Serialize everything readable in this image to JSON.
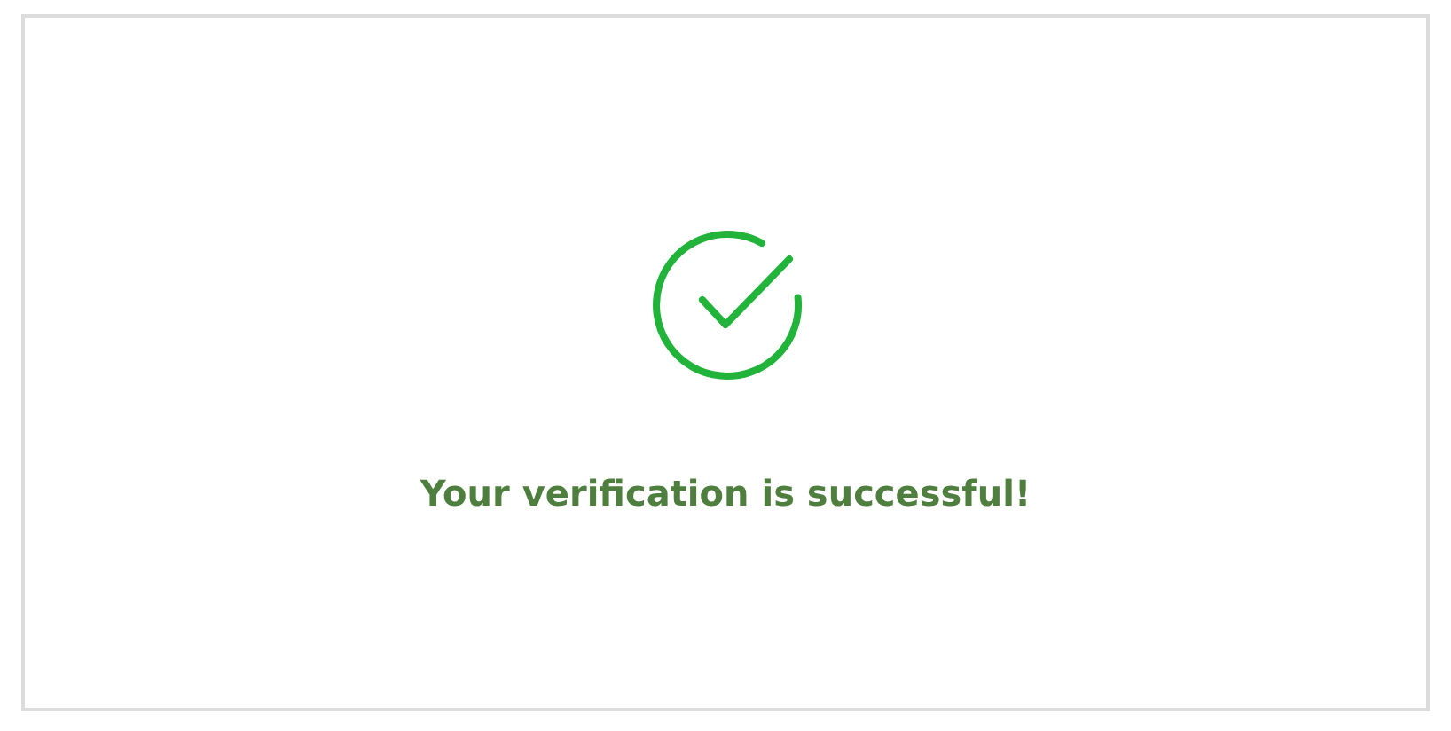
{
  "message": "Your verification is successful!"
}
